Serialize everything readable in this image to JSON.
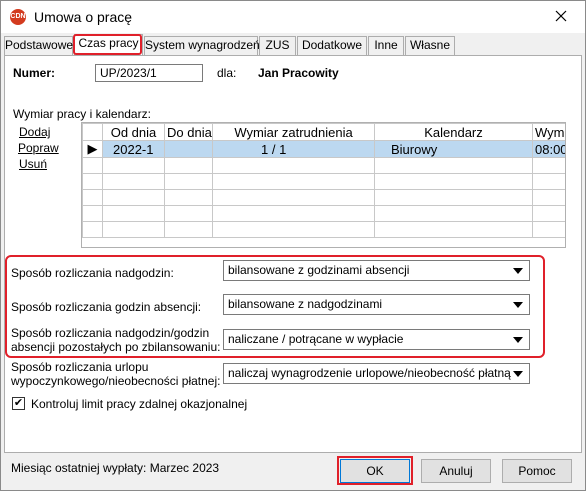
{
  "window": {
    "title": "Umowa o pracę",
    "app_icon_text": "CDN"
  },
  "tabs": [
    {
      "label": "Podstawowe"
    },
    {
      "label": "Czas pracy"
    },
    {
      "label": "System wynagrodzeń"
    },
    {
      "label": "ZUS"
    },
    {
      "label": "Dodatkowe"
    },
    {
      "label": "Inne"
    },
    {
      "label": "Własne"
    }
  ],
  "active_tab": "Czas pracy",
  "header": {
    "numer_label": "Numer:",
    "numer_value": "UP/2023/1",
    "dla_label": "dla:",
    "employee": "Jan Pracowity"
  },
  "calendar_section": {
    "title": "Wymiar pracy i kalendarz:",
    "links": {
      "add": "Dodaj",
      "edit": "Popraw",
      "delete": "Usuń"
    },
    "columns": [
      "Od dnia",
      "Do dnia",
      "Wymiar zatrudnienia",
      "Kalendarz",
      "Wymi"
    ],
    "rows": [
      [
        "2022-1",
        "",
        "1 / 1",
        "Biurowy",
        "08:00"
      ]
    ],
    "row_marker": "▶"
  },
  "settings": {
    "overtime_label": "Sposób rozliczania nadgodzin:",
    "overtime_value": "bilansowane z godzinami absencji",
    "absence_label": "Sposób rozliczania godzin absencji:",
    "absence_value": "bilansowane z nadgodzinami",
    "remaining_label_1": "Sposób rozliczania nadgodzin/godzin",
    "remaining_label_2": "absencji pozostałych po zbilansowaniu:",
    "remaining_value": "naliczane / potrącane w wypłacie",
    "leave_label_1": "Sposób rozliczania urlopu",
    "leave_label_2": "wypoczynkowego/nieobecności płatnej:",
    "leave_value": "naliczaj wynagrodzenie urlopowe/nieobecność płatną"
  },
  "remote_work": {
    "label": "Kontroluj limit pracy zdalnej okazjonalnej",
    "checked": "✔"
  },
  "footer": {
    "last_payout": "Miesiąc ostatniej wypłaty: Marzec 2023",
    "ok": "OK",
    "cancel": "Anuluj",
    "help": "Pomoc"
  },
  "colors": {
    "highlight": "#e0202a",
    "selection": "#bcd8f0",
    "accent": "#0078d7"
  }
}
